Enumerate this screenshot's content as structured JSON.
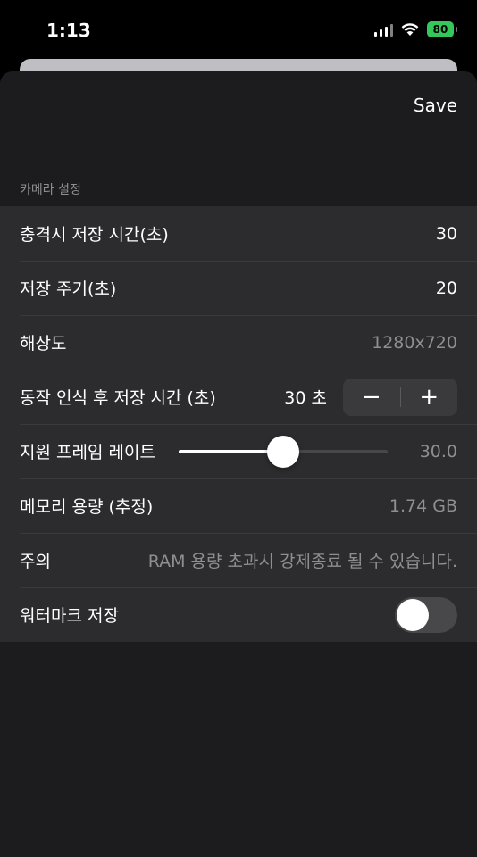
{
  "status_bar": {
    "time": "1:13",
    "battery": "80"
  },
  "header": {
    "save_label": "Save"
  },
  "section": {
    "title": "카메라 설정"
  },
  "rows": {
    "impact_time": {
      "label": "충격시 저장 시간(초)",
      "value": "30"
    },
    "save_cycle": {
      "label": "저장 주기(초)",
      "value": "20"
    },
    "resolution": {
      "label": "해상도",
      "value": "1280x720"
    },
    "motion_time": {
      "label": "동작 인식 후 저장 시간 (초)",
      "value": "30 초",
      "minus": "−",
      "plus": "+"
    },
    "frame_rate": {
      "label": "지원 프레임 레이트",
      "value": "30.0",
      "slider_fraction": 0.5
    },
    "memory": {
      "label": "메모리 용량 (추정)",
      "value": "1.74 GB"
    },
    "caution": {
      "label": "주의",
      "value": "RAM 용량 초과시 강제종료 될 수 있습니다."
    },
    "watermark": {
      "label": "워터마크 저장",
      "enabled": false
    }
  },
  "colors": {
    "battery": "#34c759",
    "sheet": "#1c1c1e",
    "row": "#2c2c2e",
    "secondary_text": "#8e8e93"
  }
}
